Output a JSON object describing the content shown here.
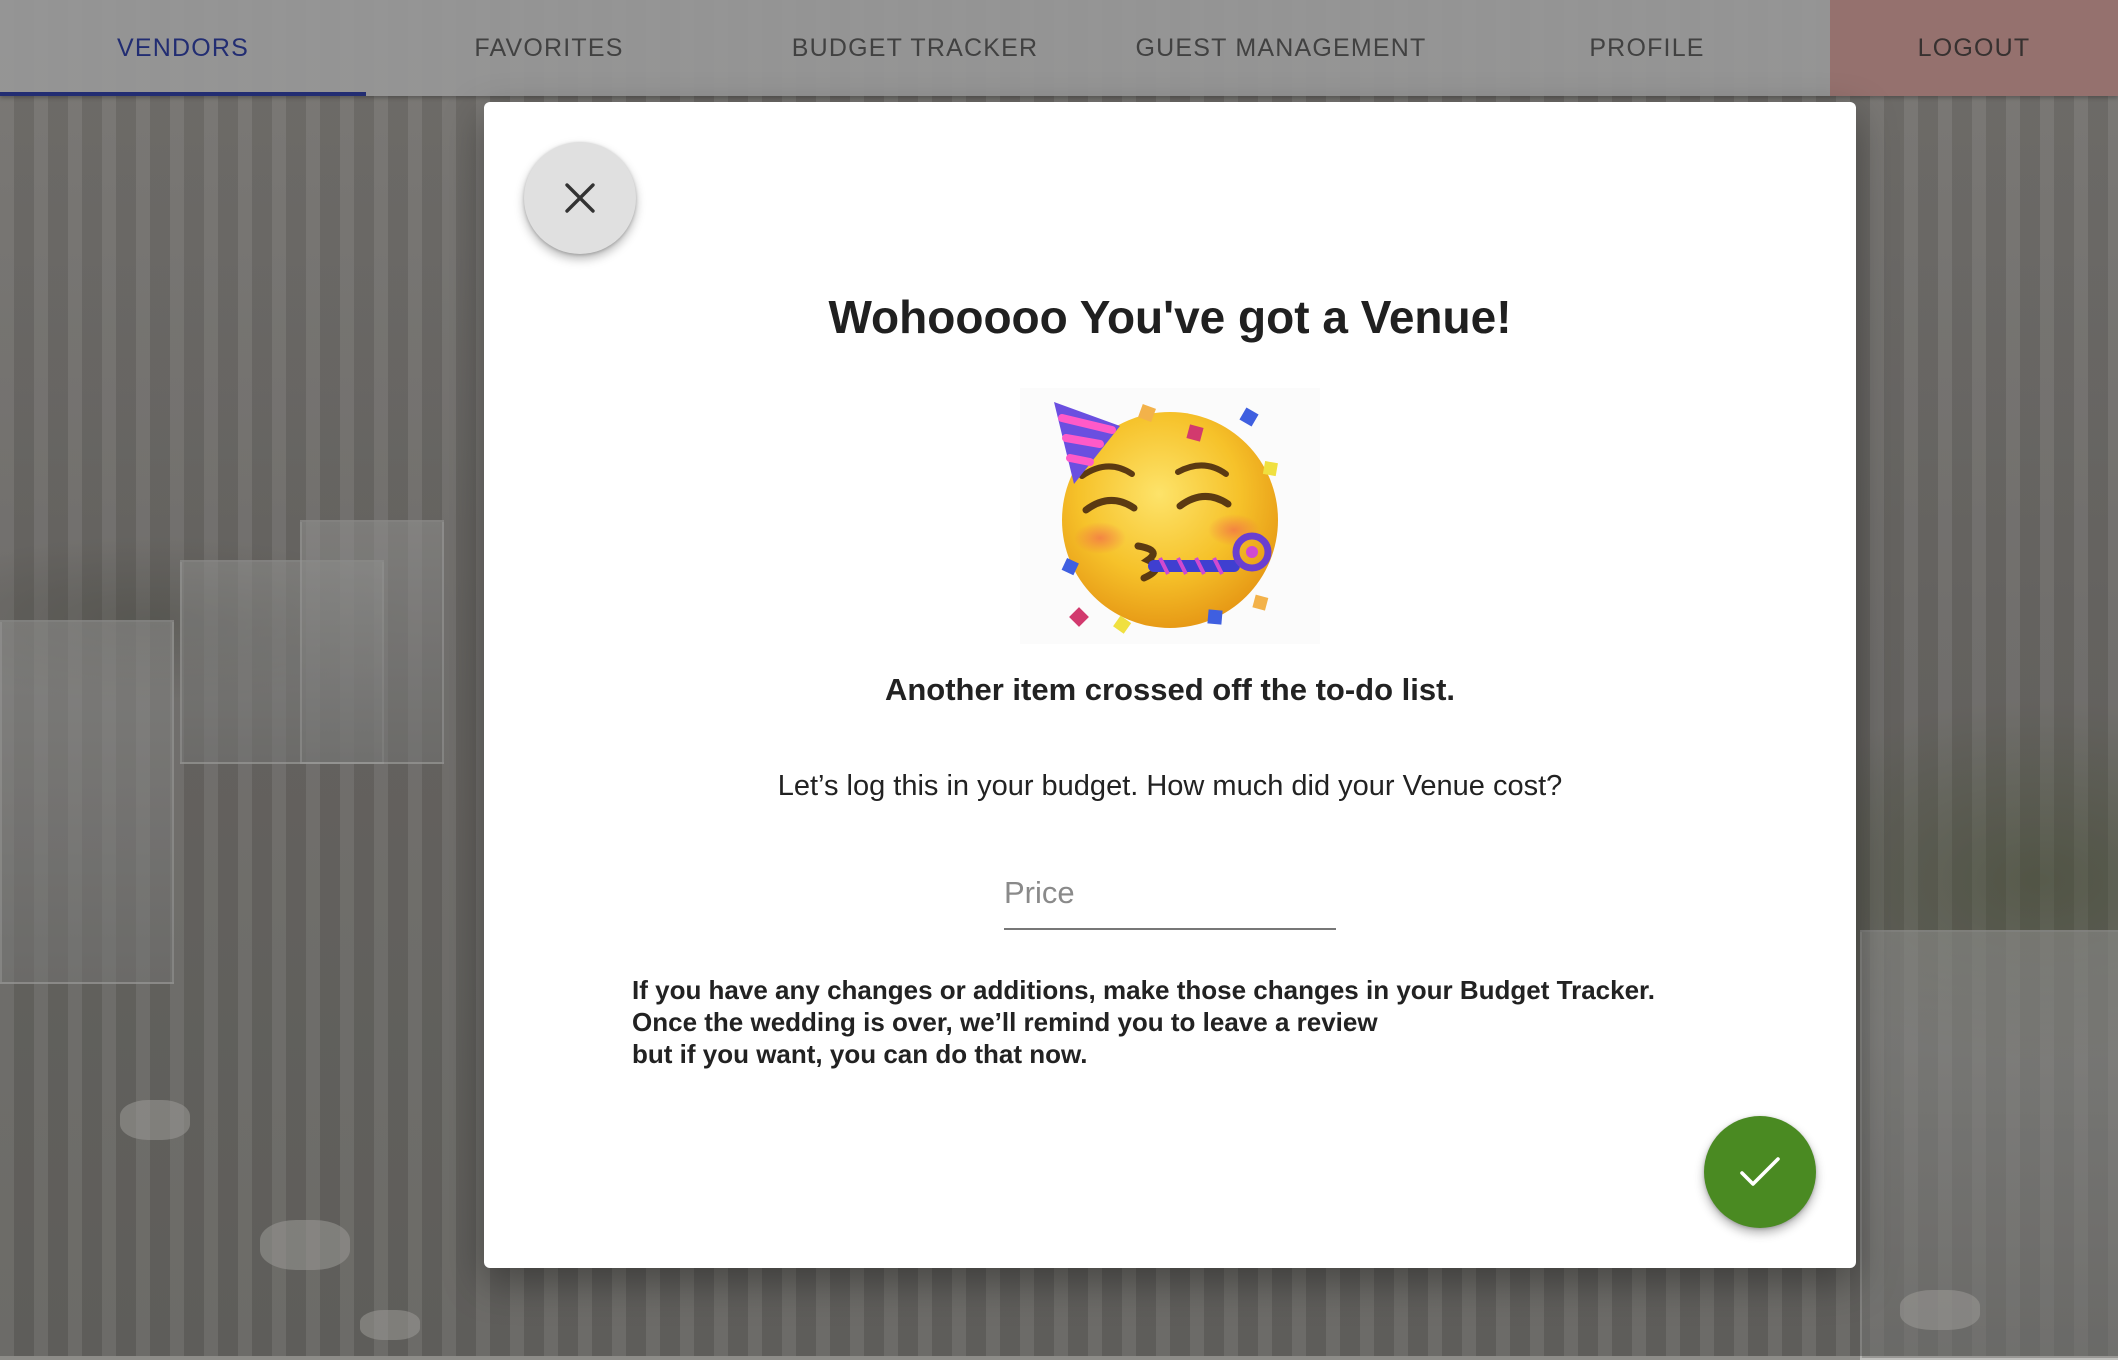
{
  "nav": {
    "tabs": [
      {
        "label": "VENDORS",
        "active": true
      },
      {
        "label": "FAVORITES",
        "active": false
      },
      {
        "label": "BUDGET TRACKER",
        "active": false
      },
      {
        "label": "GUEST MANAGEMENT",
        "active": false
      },
      {
        "label": "PROFILE",
        "active": false
      },
      {
        "label": "LOGOUT",
        "active": false
      }
    ]
  },
  "modal": {
    "title": "Wohooooo You've got a Venue!",
    "emoji": "partying-face",
    "subtitle": "Another item crossed off the to-do list.",
    "prompt": "Let’s log this in your budget. How much did your Venue cost?",
    "price_placeholder": "Price",
    "price_value": "",
    "note_lines": [
      "If you have any changes or additions, make those changes in your Budget Tracker.",
      "Once the wedding is over, we’ll remind you to leave a review",
      "but if you want, you can do that now."
    ],
    "close_icon": "close-icon",
    "confirm_icon": "check-icon"
  },
  "colors": {
    "active_tab": "#303f9f",
    "logout_bg": "#cf9d99",
    "confirm_button": "#4a8a22",
    "close_button": "#e0e0e0"
  }
}
